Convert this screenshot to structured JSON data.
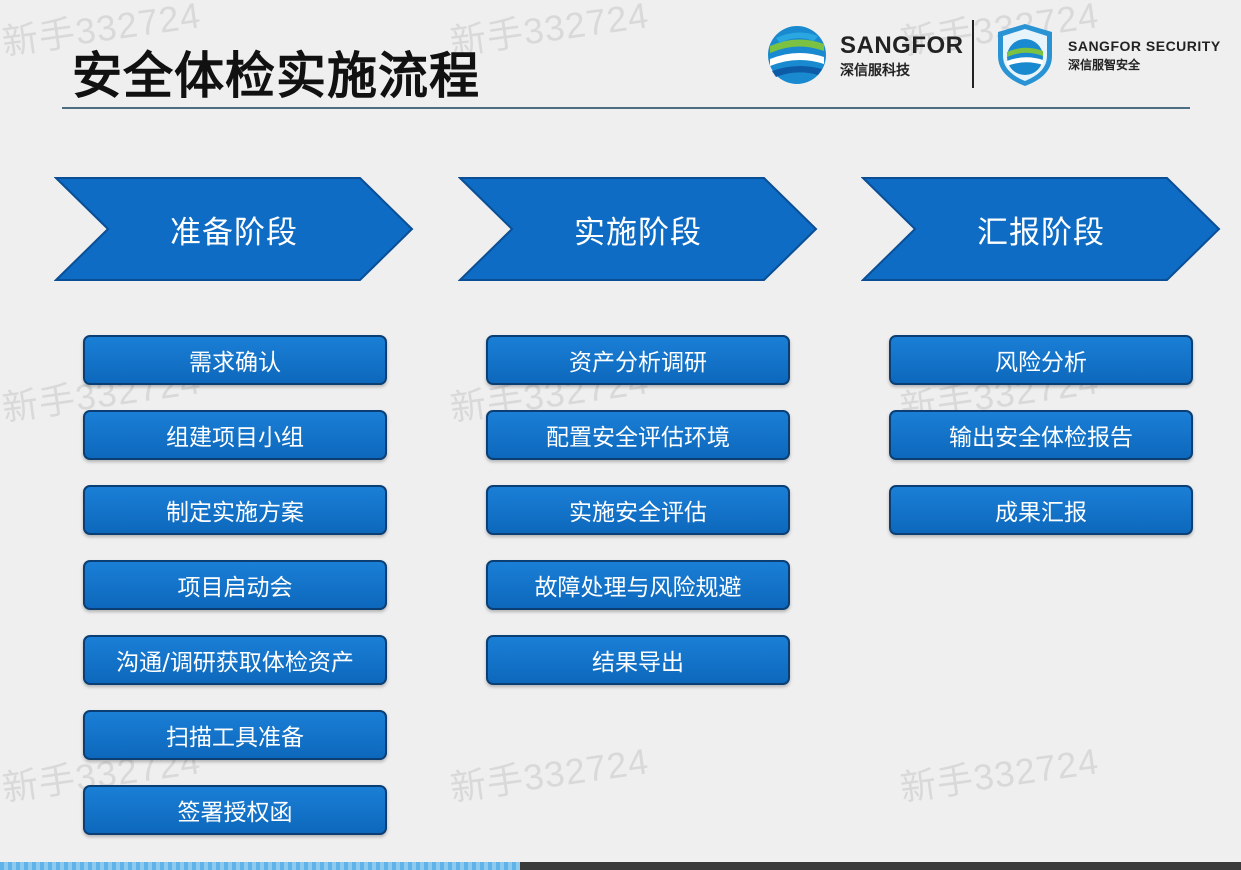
{
  "watermark": "新手332724",
  "title": "安全体检实施流程",
  "logos": {
    "left": {
      "name": "SANGFOR",
      "sub": "深信服科技"
    },
    "right": {
      "name": "SANGFOR SECURITY",
      "sub": "深信服智安全"
    }
  },
  "colors": {
    "stage_blue": "#0e6cc4",
    "button_blue": "#1275cc",
    "button_border": "#0b3f74",
    "title_line": "#4d6d82"
  },
  "stages": [
    {
      "label": "准备阶段",
      "steps": [
        "需求确认",
        "组建项目小组",
        "制定实施方案",
        "项目启动会",
        "沟通/调研获取体检资产",
        "扫描工具准备",
        "签署授权函"
      ]
    },
    {
      "label": "实施阶段",
      "steps": [
        "资产分析调研",
        "配置安全评估环境",
        "实施安全评估",
        "故障处理与风险规避",
        "结果导出"
      ]
    },
    {
      "label": "汇报阶段",
      "steps": [
        "风险分析",
        "输出安全体检报告",
        "成果汇报"
      ]
    }
  ]
}
